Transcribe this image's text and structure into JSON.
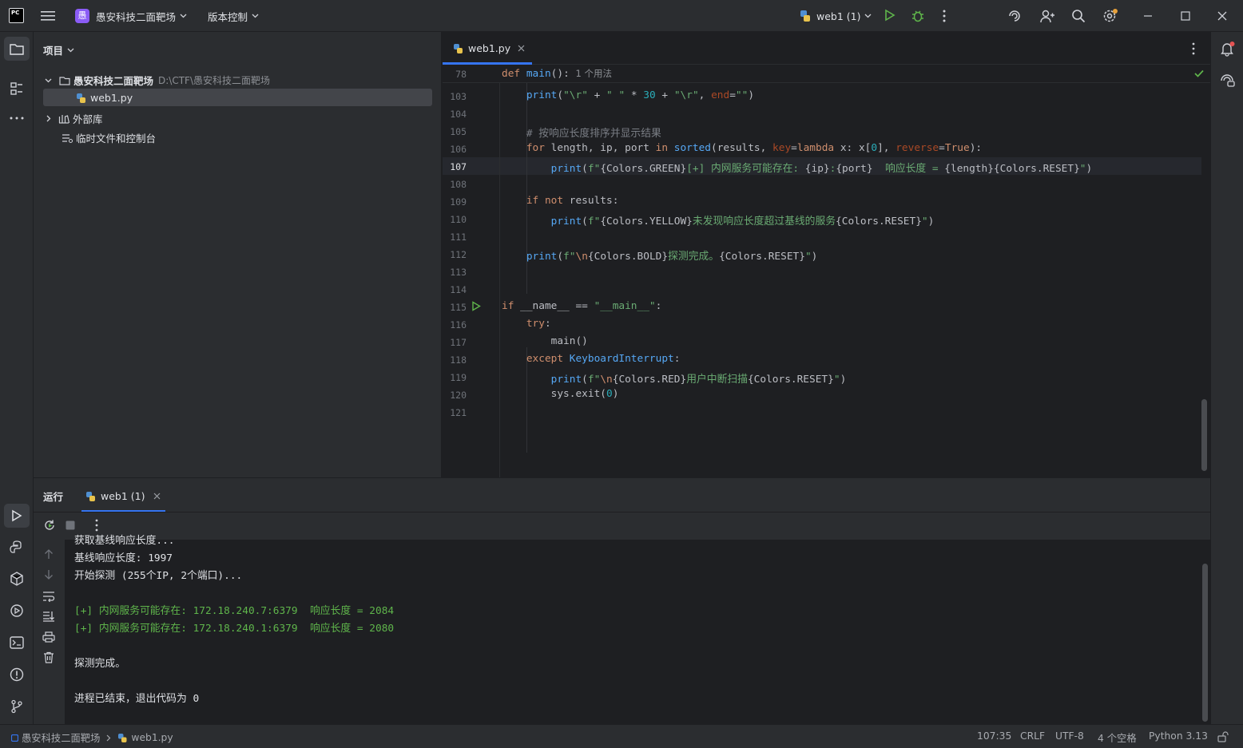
{
  "titlebar": {
    "app_logo": "PC",
    "project_badge": "愚",
    "project_name": "愚安科技二面靶场",
    "vcs": "版本控制",
    "run_config": "web1 (1)"
  },
  "project_panel": {
    "title": "项目",
    "root_name": "愚安科技二面靶场",
    "root_path": "D:\\CTF\\愚安科技二面靶场",
    "file": "web1.py",
    "external_libs": "外部库",
    "scratches": "临时文件和控制台"
  },
  "editor": {
    "tab": "web1.py",
    "sticky_line": "78",
    "sticky_hint": "1 个用法",
    "line_numbers": [
      "103",
      "104",
      "105",
      "106",
      "107",
      "108",
      "109",
      "110",
      "111",
      "112",
      "113",
      "114",
      "115",
      "116",
      "117",
      "118",
      "119",
      "120",
      "121"
    ]
  },
  "run_panel": {
    "title": "运行",
    "tab": "web1 (1)",
    "lines": [
      "获取基线响应长度...",
      "基线响应长度: 1997",
      "开始探测 (255个IP, 2个端口)...",
      "",
      "[+] 内网服务可能存在: 172.18.240.7:6379  响应长度 = 2084",
      "[+] 内网服务可能存在: 172.18.240.1:6379  响应长度 = 2080",
      "",
      "探测完成。",
      "",
      "进程已结束，退出代码为 0"
    ]
  },
  "statusbar": {
    "crumb_project": "愚安科技二面靶场",
    "crumb_file": "web1.py",
    "position": "107:35",
    "line_sep": "CRLF",
    "encoding": "UTF-8",
    "indent": "4 个空格",
    "interpreter": "Python 3.13"
  },
  "colors": {
    "accent": "#3574f0",
    "project_badge": "#8b5cf6",
    "run_green": "#5fb54b",
    "debug_green": "#5fb54b"
  }
}
